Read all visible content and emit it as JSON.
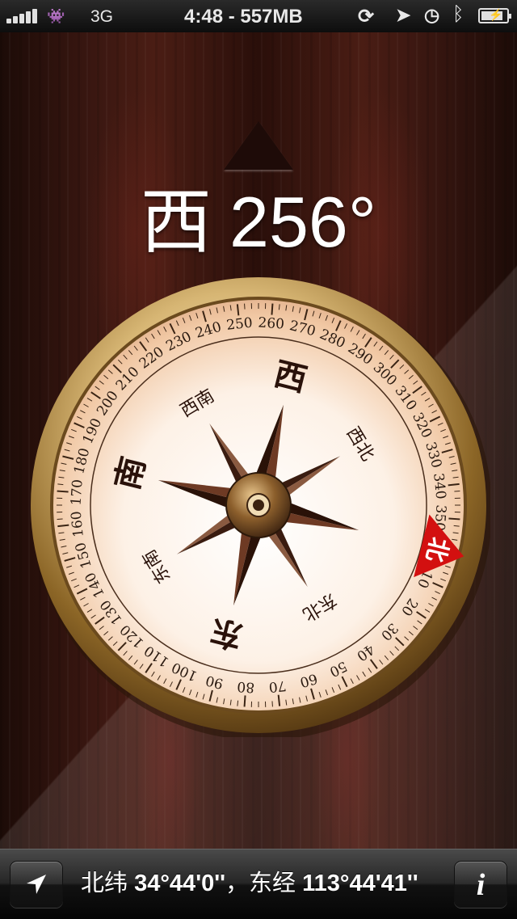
{
  "status_bar": {
    "network": "3G",
    "time_memory": "4:48 - 557MB",
    "icons": [
      "signal-bars-icon",
      "space-invader-icon",
      "rotation-lock-icon",
      "location-arrow-icon",
      "clock-icon",
      "bluetooth-icon",
      "battery-charging-icon"
    ]
  },
  "heading": {
    "direction": "西",
    "degrees": "256°",
    "bearing": 256
  },
  "compass": {
    "cardinals": [
      "北",
      "东",
      "南",
      "西"
    ],
    "intercardinals": [
      "东北",
      "东南",
      "西南",
      "西北"
    ],
    "north_marker_color": "#d31010",
    "scale_numbers": [
      "0",
      "10",
      "20",
      "30",
      "40",
      "50",
      "60",
      "70",
      "80",
      "90",
      "100",
      "110",
      "120",
      "130",
      "140",
      "150",
      "160",
      "170",
      "180",
      "190",
      "200",
      "210",
      "220",
      "230",
      "240",
      "250",
      "260",
      "270",
      "280",
      "290",
      "300",
      "310",
      "320",
      "330",
      "340",
      "350"
    ]
  },
  "bottom_bar": {
    "lat_label": "北纬",
    "lat_value": "34°44'0''",
    "separator": "，",
    "lon_label": "东经",
    "lon_value": "113°44'41''",
    "location_button_icon": "location-arrow-icon",
    "info_button_label": "i"
  }
}
